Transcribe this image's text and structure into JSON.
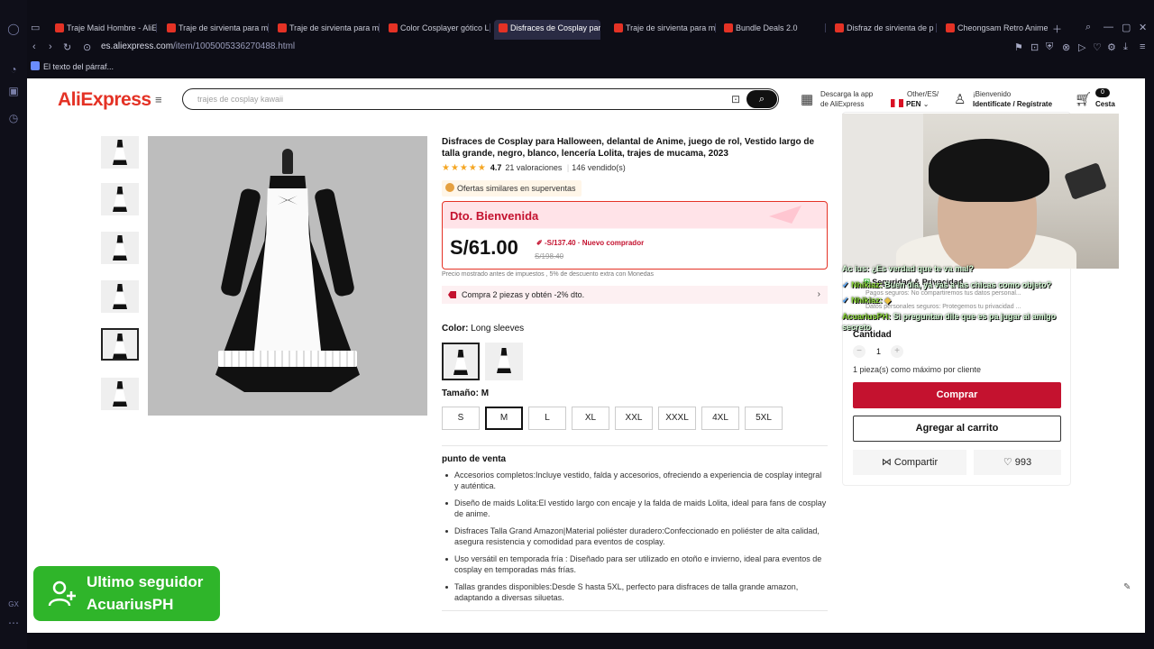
{
  "browser": {
    "tabs": [
      {
        "label": "Traje Maid Hombre - AliE",
        "active": false
      },
      {
        "label": "Traje de sirvienta para m",
        "active": false
      },
      {
        "label": "Traje de sirvienta para m",
        "active": false
      },
      {
        "label": "Color Cosplayer gótico L",
        "active": false
      },
      {
        "label": "Disfraces de Cosplay para",
        "active": true
      },
      {
        "label": "Traje de sirvienta para m",
        "active": false
      },
      {
        "label": "Bundle Deals 2.0",
        "active": false
      },
      {
        "label": "Disfraz de sirvienta de p",
        "active": false
      },
      {
        "label": "Cheongsam Retro Anime",
        "active": false
      }
    ],
    "address": {
      "domain": "es.aliexpress.com",
      "path": "/item/1005005336270488.html"
    },
    "bookmark": "El texto del párraf...",
    "rail_bottom_label": "GX"
  },
  "header": {
    "logo_main": "AliExpress",
    "search_placeholder": "trajes de cosplay kawaii",
    "app": {
      "line1": "Descarga la app",
      "line2": "de AliExpress"
    },
    "region": {
      "line1": "Other/ES/",
      "line2": "PEN"
    },
    "account": {
      "line1": "¡Bienvenido",
      "line2": "Identifícate / Regístrate"
    },
    "cart": {
      "count": "0",
      "label": "Cesta"
    }
  },
  "product": {
    "title": "Disfraces de Cosplay para Halloween, delantal de Anime, juego de rol, Vestido largo de talla grande, negro, blanco, lencería Lolita, trajes de mucama, 2023",
    "stars": "★★★★★",
    "rating": "4.7",
    "reviews": "21 valoraciones",
    "sold": "146 vendido(s)",
    "offer_tag": "Ofertas similares en superventas",
    "deal": {
      "title": "Dto. Bienvenida",
      "price": "S/61.00",
      "discount": "-S/137.40 · Nuevo comprador",
      "old_price": "S/198.40"
    },
    "tax_note": "Precio mostrado antes de impuestos , 5% de descuento extra con Monedas",
    "bundle": "Compra 2 piezas y obtén -2% dto.",
    "color_label": "Color: ",
    "color_value": "Long sleeves",
    "size_label": "Tamaño: ",
    "size_value": "M",
    "sizes": [
      "S",
      "M",
      "L",
      "XL",
      "XXL",
      "XXXL",
      "4XL",
      "5XL"
    ],
    "selling_points_title": "punto de venta",
    "selling_points": [
      "Accesorios completos:Incluye vestido, falda y accesorios, ofreciendo a experiencia de cosplay integral y auténtica.",
      "Diseño de maids Lolita:El vestido largo con encaje y la falda de maids Lolita, ideal para fans de cosplay de anime.",
      "Disfraces Talla Grand Amazon|Material  poliéster duradero:Confeccionado en poliéster de alta calidad, asegura resistencia y comodidad para eventos de cosplay.",
      "Uso versátil en temporada fría : Diseñado para ser utilizado en otoño e invierno, ideal para eventos de cosplay en temporadas más frías.",
      "Tallas grandes disponibles:Desde S hasta 5XL, perfecto para disfraces de talla grande amazon, adaptando a diversas siluetas."
    ]
  },
  "buybox": {
    "security_title": "Seguridad & Privacidad",
    "security_line1": "Pagos seguros: No compartiremos tus datos personal...",
    "security_line2": "Datos personales seguros: Protegemos tu privacidad ...",
    "qty_label": "Cantidad",
    "qty_value": "1",
    "qty_note": "1 pieza(s) como máximo por cliente",
    "buy_label": "Comprar",
    "cart_label": "Agregar al carrito",
    "share_label": "Compartir",
    "likes": "993"
  },
  "stream": {
    "chat": [
      {
        "name": "",
        "text": "Ac    ius: ¿Es verdad que te va mal?"
      },
      {
        "name": "Nhikiaz:",
        "text": "Buen dia, ya vas a las chicas como objeto?"
      },
      {
        "name": "Nhikiaz:",
        "text": ""
      },
      {
        "name": "AcuariusPH:",
        "text": "Si preguntan dile que es pa jugar al amigo"
      },
      {
        "name": "",
        "text": "secreto"
      }
    ],
    "follower_title": "Ultimo seguidor",
    "follower_name": "AcuariusPH"
  }
}
